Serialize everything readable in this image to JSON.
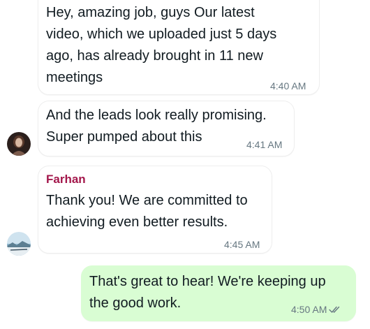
{
  "messages": [
    {
      "text": "Hey, amazing job, guys  Our latest\nvideo, which we uploaded just 5 days\nago, has already brought in 11 new\nmeetings",
      "time": "4:40 AM"
    },
    {
      "text": "And the leads look really promising.\nSuper pumped about this",
      "time": "4:41 AM",
      "avatar": "woman-avatar"
    },
    {
      "sender": "Farhan",
      "text": "Thank you! We are committed to\nachieving even better results.",
      "time": "4:45 AM",
      "avatar": "landscape-avatar"
    },
    {
      "text": "That's great to hear! We're keeping up\nthe good work.",
      "time": "4:50 AM",
      "status_icon": "double-check-icon"
    }
  ],
  "colors": {
    "outgoing_bubble": "#d9fdd3",
    "incoming_bubble": "#ffffff",
    "sender_name": "#a3174b",
    "timestamp": "#667781"
  }
}
